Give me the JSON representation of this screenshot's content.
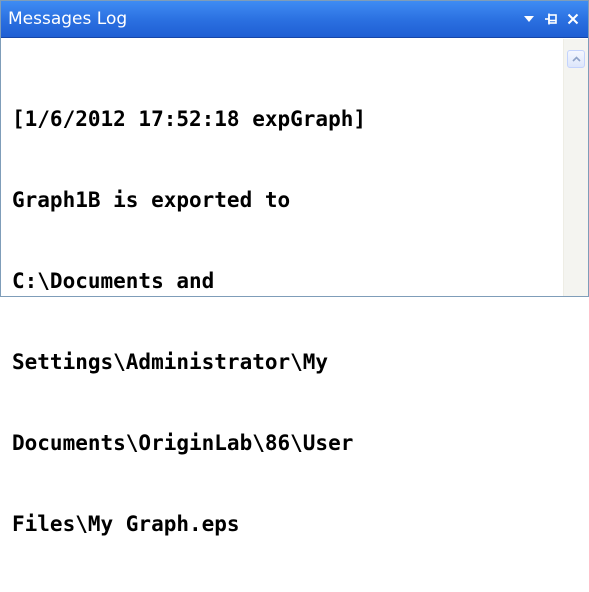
{
  "window": {
    "title": "Messages Log"
  },
  "titlebar_buttons": {
    "dropdown_icon": "chevron-down-icon",
    "pin_icon": "pin-icon",
    "close_icon": "close-icon"
  },
  "log": {
    "lines": [
      "[1/6/2012 17:52:18 expGraph]",
      "Graph1B is exported to",
      "C:\\Documents and",
      "Settings\\Administrator\\My",
      "Documents\\OriginLab\\86\\User",
      "Files\\My Graph.eps"
    ]
  },
  "colors": {
    "titlebar": "#2a6fe0",
    "title_text": "#ffffff",
    "log_text": "#000000"
  }
}
